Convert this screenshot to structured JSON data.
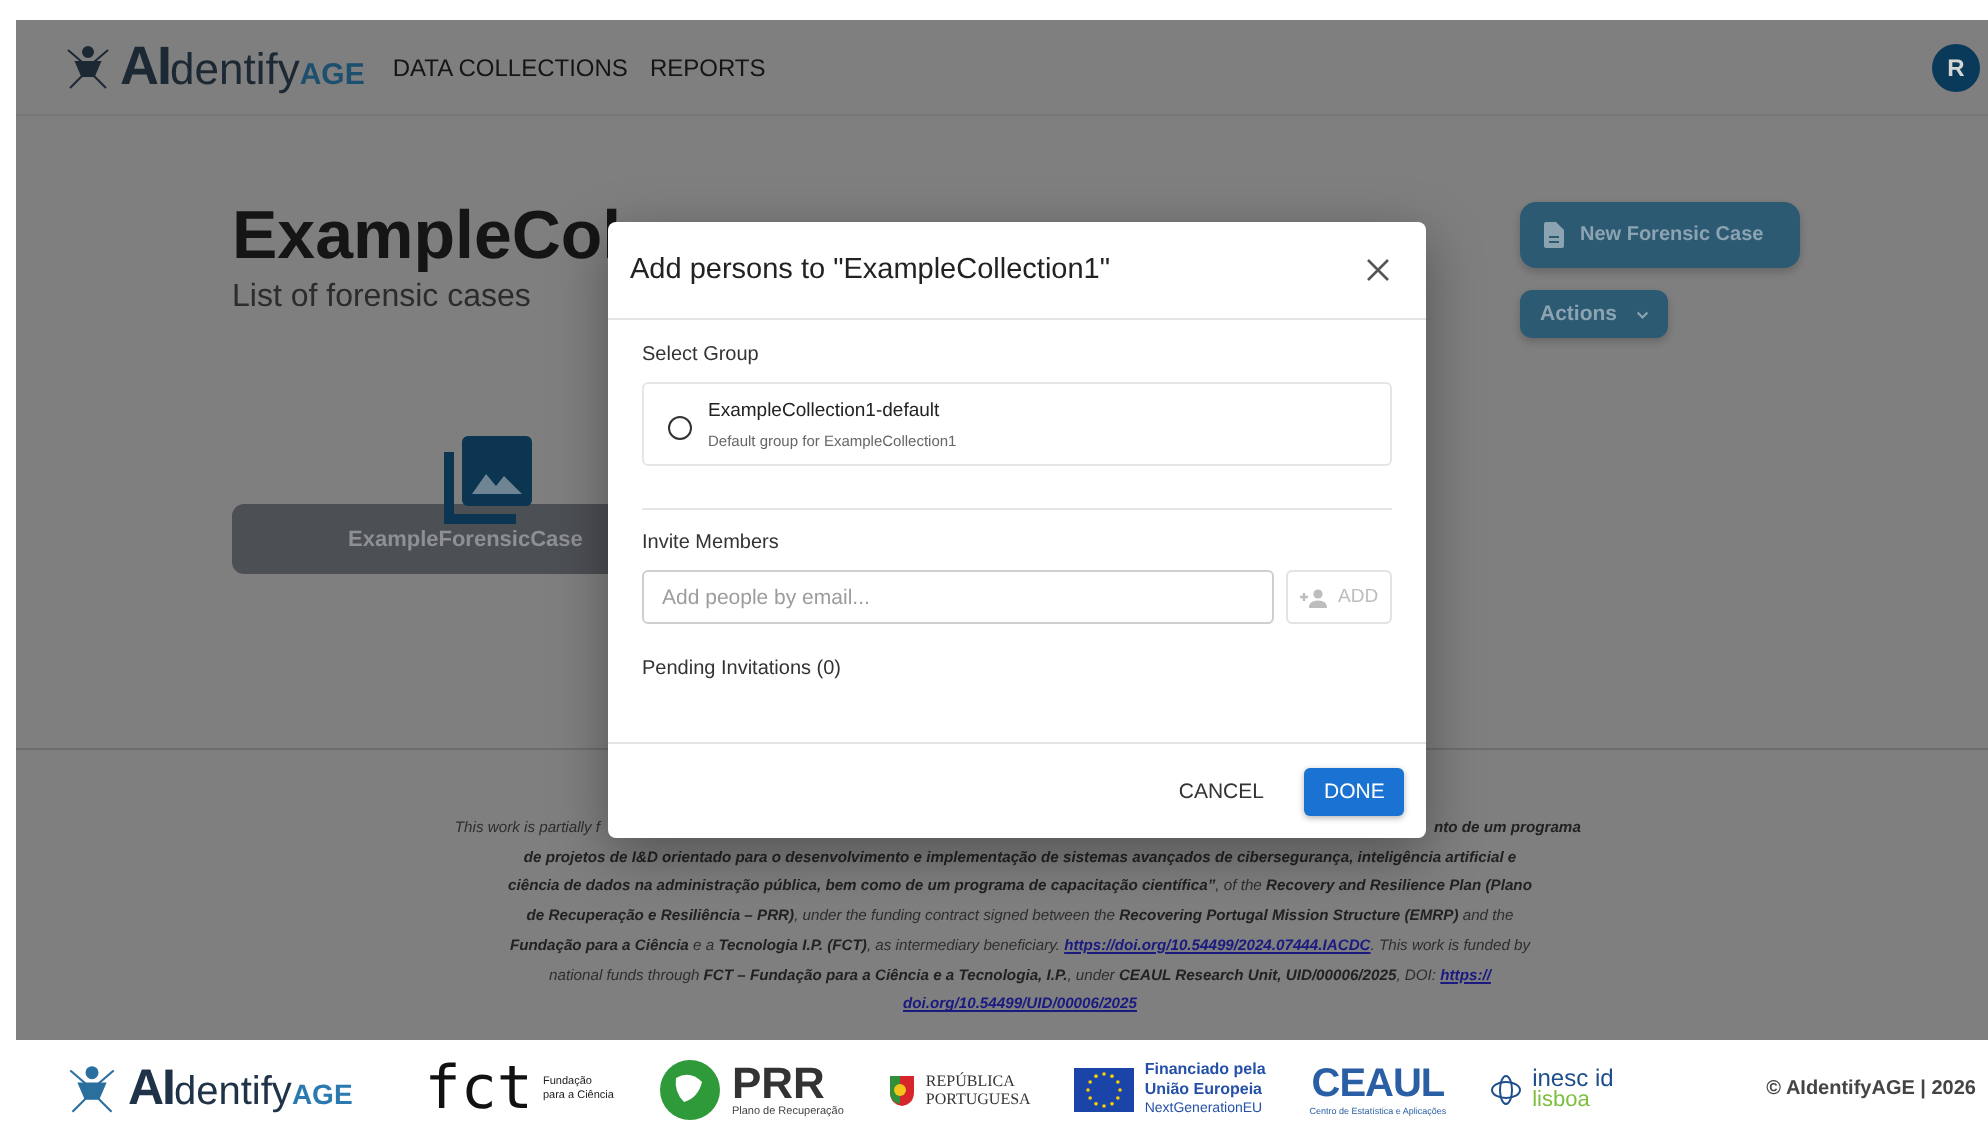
{
  "header": {
    "logo": {
      "strong": "AI",
      "light": "dentify",
      "accent": "AGE"
    },
    "nav": [
      "DATA COLLECTIONS",
      "REPORTS"
    ],
    "avatar": "R"
  },
  "page": {
    "title": "ExampleCol",
    "subtitle": "List of forensic cases",
    "actions": [
      {
        "label": "New Forensic Case",
        "kind": "new-case"
      },
      {
        "label": "Actions",
        "kind": "menu"
      }
    ],
    "cases": [
      {
        "name": "ExampleForensicCase"
      }
    ]
  },
  "funding": {
    "first_left": [
      {
        "text": "This work is partially f",
        "kind": "plain"
      }
    ],
    "first_right": [
      {
        "text": "nto de um programa",
        "kind": "bold"
      }
    ],
    "lines": [
      [
        {
          "text": "de projetos de I&D orientado para o desenvolvimento e implementação de sistemas avançados de cibersegurança, inteligência artificial e",
          "kind": "bold"
        }
      ],
      [
        {
          "text": "ciência de dados na administração pública, bem como de um programa de capacitação científica”",
          "kind": "bold"
        },
        {
          "text": ", of the ",
          "kind": "plain"
        },
        {
          "text": "Recovery and Resilience Plan (Plano",
          "kind": "bold"
        }
      ],
      [
        {
          "text": "de Recuperação e Resiliência – PRR)",
          "kind": "bold"
        },
        {
          "text": ", under the funding contract signed between the ",
          "kind": "plain"
        },
        {
          "text": "Recovering Portugal Mission Structure (EMRP)",
          "kind": "bold"
        },
        {
          "text": " and the",
          "kind": "plain"
        }
      ],
      [
        {
          "text": "Fundação para a Ciência",
          "kind": "bold"
        },
        {
          "text": " e a ",
          "kind": "plain"
        },
        {
          "text": "Tecnologia I.P. (FCT)",
          "kind": "bold"
        },
        {
          "text": ", as intermediary beneficiary. ",
          "kind": "plain"
        },
        {
          "text": "https://doi.org/10.54499/2024.07444.IACDC",
          "kind": "link"
        },
        {
          "text": ". This work is funded by",
          "kind": "plain"
        }
      ],
      [
        {
          "text": "national funds through ",
          "kind": "plain"
        },
        {
          "text": "FCT – Fundação para a Ciência e a Tecnologia, I.P.",
          "kind": "bold"
        },
        {
          "text": ", under ",
          "kind": "plain"
        },
        {
          "text": "CEAUL Research Unit, UID/00006/2025",
          "kind": "bold"
        },
        {
          "text": ", DOI: ",
          "kind": "plain"
        },
        {
          "text": "https://",
          "kind": "link"
        }
      ],
      [
        {
          "text": "doi.org/10.54499/UID/00006/2025",
          "kind": "link"
        }
      ]
    ]
  },
  "dialog": {
    "title": "Add persons to \"ExampleCollection1\"",
    "group_label": "Select Group",
    "groups": [
      {
        "name": "ExampleCollection1-default",
        "description": "Default group for ExampleCollection1",
        "selected": false
      }
    ],
    "invite_label": "Invite Members",
    "email": {
      "placeholder": "Add people by email..."
    },
    "add_button": {
      "label": "ADD",
      "disabled": true
    },
    "pending": "Pending Invitations (0)",
    "buttons": [
      {
        "label": "CANCEL",
        "kind": "text"
      },
      {
        "label": "DONE",
        "kind": "primary"
      }
    ]
  },
  "footer": {
    "logos": [
      {
        "kind": "aidentify",
        "strong": "AI",
        "light": "dentify",
        "accent": "AGE"
      },
      {
        "kind": "fct",
        "mark": "fct",
        "lines": [
          "Fundação",
          "para a Ciência"
        ]
      },
      {
        "kind": "prr",
        "mark": "PRR",
        "lines": [
          "Plano de Recuperação"
        ]
      },
      {
        "kind": "republica",
        "lines": [
          "REPÚBLICA",
          "PORTUGUESA"
        ]
      },
      {
        "kind": "eu",
        "lines": [
          "Financiado pela",
          "União Europeia",
          "NextGenerationEU"
        ]
      },
      {
        "kind": "ceaul",
        "mark": "CEAUL",
        "lines": [
          "Centro de Estatística e Aplicações"
        ]
      },
      {
        "kind": "inesc",
        "mark": "inesc id",
        "lines": [
          "lisboa"
        ]
      }
    ],
    "copyright": "© AIdentifyAGE | 2026"
  }
}
